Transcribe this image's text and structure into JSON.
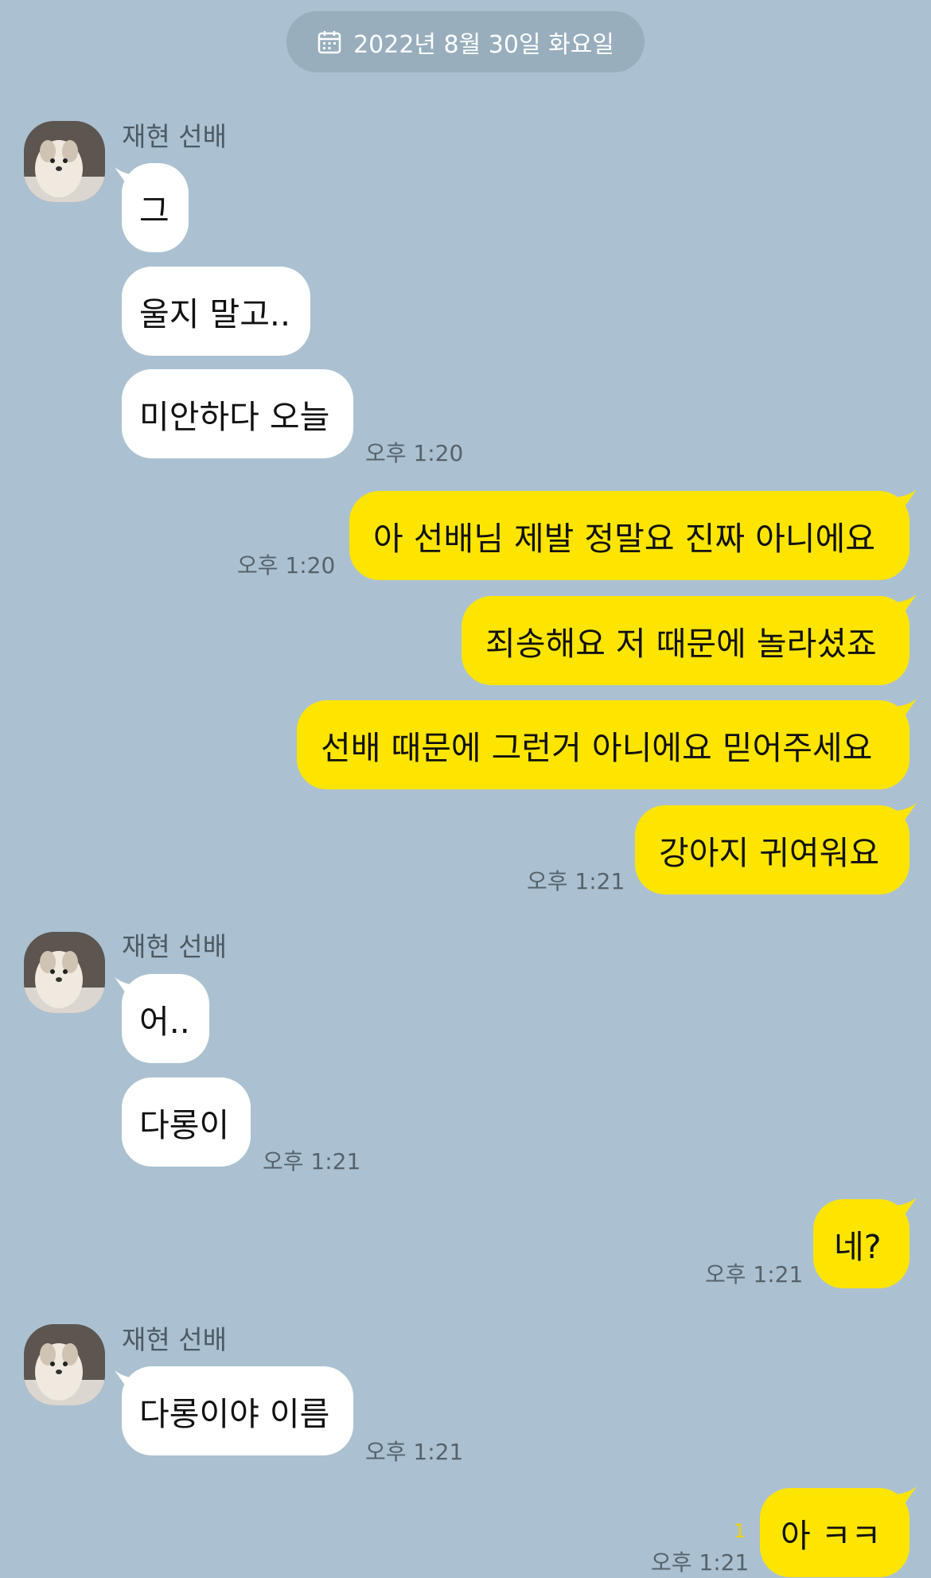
{
  "date_divider": {
    "icon": "calendar-icon",
    "text": "2022년 8월 30일 화요일"
  },
  "colors": {
    "background": "#abc1d1",
    "incoming_bubble": "#ffffff",
    "outgoing_bubble": "#fee500",
    "unread_count": "#f1d000"
  },
  "messages": {
    "g1": {
      "sender": "재현 선배",
      "b1": "그",
      "b2": "울지 말고..",
      "b3": "미안하다 오늘",
      "time": "오후 1:20"
    },
    "g2": {
      "b1": "아 선배님 제발 정말요 진짜 아니에요",
      "time1": "오후 1:20",
      "b2": "죄송해요 저 때문에 놀라셨죠",
      "b3": "선배 때문에 그런거 아니에요 믿어주세요",
      "b4": "강아지 귀여워요",
      "time2": "오후 1:21"
    },
    "g3": {
      "sender": "재현 선배",
      "b1": "어..",
      "b2": "다롱이",
      "time": "오후 1:21"
    },
    "g4": {
      "b1": "네?",
      "time": "오후 1:21"
    },
    "g5": {
      "sender": "재현 선배",
      "b1": "다롱이야 이름",
      "time": "오후 1:21"
    },
    "g6": {
      "b1": "아 ㅋㅋ",
      "unread": "1",
      "time": "오후 1:21"
    }
  }
}
